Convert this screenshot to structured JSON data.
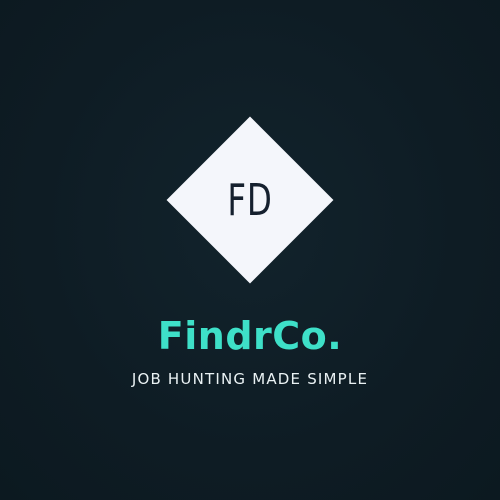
{
  "logo": {
    "monogram": "FD",
    "brand_name": "FindrCo.",
    "tagline": "JOB HUNTING MADE SIMPLE"
  },
  "colors": {
    "background": "#0f1e26",
    "diamond": "#f4f6fb",
    "monogram": "#15202e",
    "brand_name": "#3ee0c8",
    "tagline": "#eaf2f4"
  }
}
